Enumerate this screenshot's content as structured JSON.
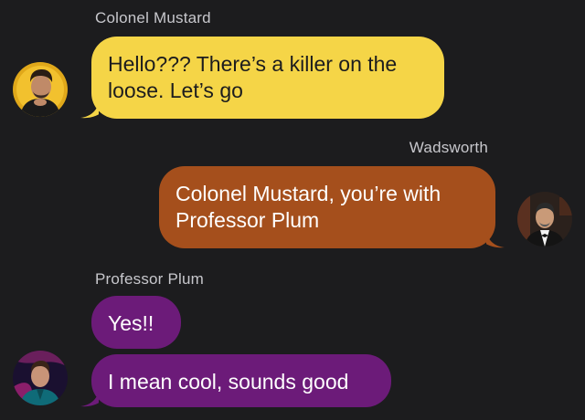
{
  "colors": {
    "background": "#1c1c1e",
    "mustard_bubble": "#f5d547",
    "wadsworth_bubble": "#a54f1c",
    "plum_bubble": "#6c1b79",
    "sender_name": "#c7c7cc"
  },
  "messages": [
    {
      "sender": "Colonel Mustard",
      "side": "left",
      "avatar_icon": "avatar-colonel-mustard",
      "bubbles": [
        "Hello??? There’s a killer on the loose. Let’s go"
      ]
    },
    {
      "sender": "Wadsworth",
      "side": "right",
      "avatar_icon": "avatar-wadsworth",
      "bubbles": [
        "Colonel Mustard, you’re with Professor Plum"
      ]
    },
    {
      "sender": "Professor Plum",
      "side": "left",
      "avatar_icon": "avatar-professor-plum",
      "bubbles": [
        "Yes!!",
        "I mean cool, sounds good"
      ]
    }
  ]
}
